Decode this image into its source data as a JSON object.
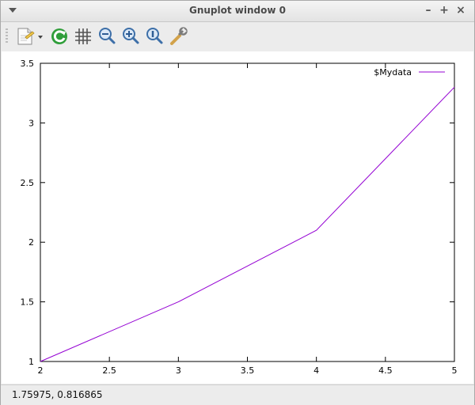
{
  "window": {
    "title": "Gnuplot window 0",
    "minimize_label": "–",
    "maximize_label": "+",
    "close_label": "×"
  },
  "toolbar": {
    "buttons": [
      {
        "name": "export-icon"
      },
      {
        "name": "replot-icon"
      },
      {
        "name": "grid-icon"
      },
      {
        "name": "zoom-previous-icon"
      },
      {
        "name": "zoom-next-icon"
      },
      {
        "name": "autoscale-icon"
      },
      {
        "name": "config-icon"
      }
    ]
  },
  "chart_data": {
    "type": "line",
    "x": [
      2,
      3,
      4,
      5
    ],
    "series": [
      {
        "name": "$Mydata",
        "values": [
          1,
          1.5,
          2.1,
          3.3
        ],
        "color": "#9400d3"
      }
    ],
    "xlim": [
      2,
      5
    ],
    "ylim": [
      1,
      3.5
    ],
    "xticks": [
      "2",
      "2.5",
      "3",
      "3.5",
      "4",
      "4.5",
      "5"
    ],
    "yticks": [
      "1",
      "1.5",
      "2",
      "2.5",
      "3",
      "3.5"
    ],
    "grid": false,
    "legend_position": "top-right"
  },
  "statusbar": {
    "coords": "1.75975,  0.816865"
  }
}
